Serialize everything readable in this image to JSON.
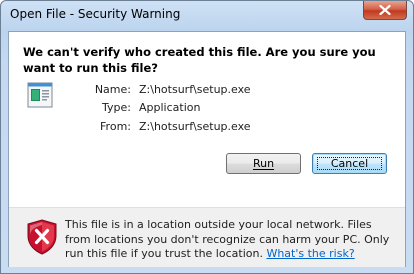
{
  "window": {
    "title": "Open File - Security Warning",
    "close_icon": "close-icon"
  },
  "heading": "We can't verify who created this file. Are you sure you want to run this file?",
  "file": {
    "icon": "executable-file-icon",
    "name_label": "Name:",
    "name_value": "Z:\\hotsurf\\setup.exe",
    "type_label": "Type:",
    "type_value": "Application",
    "from_label": "From:",
    "from_value": "Z:\\hotsurf\\setup.exe"
  },
  "buttons": {
    "run_label": "Run",
    "cancel_label": "Cancel"
  },
  "footer": {
    "icon": "shield-warning-icon",
    "message": "This file is in a location outside your local network. Files from locations you don't recognize can harm your PC. Only run this file if you trust the location.",
    "link_text": "What's the risk?"
  },
  "colors": {
    "link": "#0066cc",
    "shield_red": "#c8102e"
  }
}
